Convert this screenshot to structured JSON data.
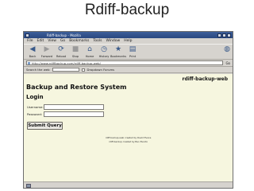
{
  "slide": {
    "title": "Rdiff-backup"
  },
  "window": {
    "title": "Rdiff-backup - Mozilla"
  },
  "menu": [
    "File",
    "Edit",
    "View",
    "Go",
    "Bookmarks",
    "Tools",
    "Window",
    "Help"
  ],
  "toolbar": {
    "back_label": "Back",
    "forward_label": "Forward",
    "reload_label": "Reload",
    "stop_label": "Stop",
    "home_label": "Home",
    "history_label": "History",
    "bookmarks_label": "Bookmarks",
    "print_label": "Print"
  },
  "address": {
    "url": "http://www.rdiffbackup.com/rdiff-backup-web/",
    "go_label": "Go"
  },
  "search": {
    "label": "Search the web",
    "option_label": "Dropdown Forums"
  },
  "page": {
    "brand": "rdiff-backup-web",
    "heading": "Backup and Restore System",
    "login_heading": "Login",
    "username_label": "Username:",
    "password_label": "Password:",
    "submit_label": "Submit Query",
    "footer_line1": "rdiff-backup-web created by David Evans",
    "footer_line2": "rdiff-backup created by Ben Escoto"
  }
}
